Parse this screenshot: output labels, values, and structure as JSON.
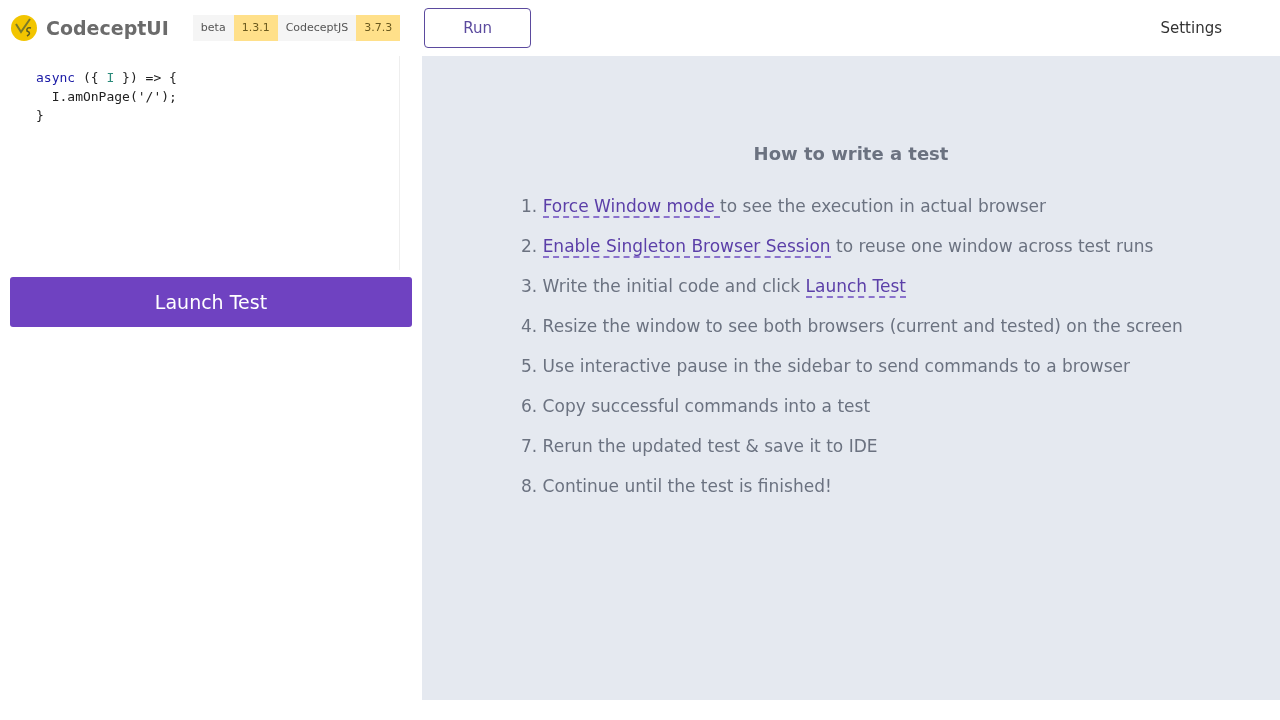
{
  "header": {
    "brand": "CodeceptUI",
    "badges": [
      {
        "label": "beta",
        "kind": "plain"
      },
      {
        "label": "1.3.1",
        "kind": "version"
      },
      {
        "label": "CodeceptJS",
        "kind": "plain"
      },
      {
        "label": "3.7.3",
        "kind": "version"
      }
    ],
    "run_button": "Run",
    "settings": "Settings"
  },
  "editor": {
    "lines": [
      [
        {
          "kind": "keyword",
          "text": "async"
        },
        {
          "kind": "plain",
          "text": " ({ "
        },
        {
          "kind": "identifier",
          "text": "I"
        },
        {
          "kind": "plain",
          "text": " }) => {"
        }
      ],
      [
        {
          "kind": "plain",
          "text": "  I.amOnPage('/');"
        }
      ],
      [
        {
          "kind": "plain",
          "text": "}"
        }
      ]
    ]
  },
  "launch_button": "Launch Test",
  "guide": {
    "title": "How to write a test",
    "steps": [
      [
        {
          "kind": "text",
          "text": "1. "
        },
        {
          "kind": "link",
          "text": "Force Window mode "
        },
        {
          "kind": "text",
          "text": "to see the execution in actual browser"
        }
      ],
      [
        {
          "kind": "text",
          "text": "2. "
        },
        {
          "kind": "link",
          "text": "Enable Singleton Browser Session"
        },
        {
          "kind": "text",
          "text": " to reuse one window across test runs"
        }
      ],
      [
        {
          "kind": "text",
          "text": "3. Write the initial code and click "
        },
        {
          "kind": "link",
          "text": "Launch Test"
        }
      ],
      [
        {
          "kind": "text",
          "text": "4. Resize the window to see both browsers (current and tested) on the screen"
        }
      ],
      [
        {
          "kind": "text",
          "text": "5. Use interactive pause in the sidebar to send commands to a browser"
        }
      ],
      [
        {
          "kind": "text",
          "text": "6. Copy successful commands into a test"
        }
      ],
      [
        {
          "kind": "text",
          "text": "7. Rerun the updated test & save it to IDE"
        }
      ],
      [
        {
          "kind": "text",
          "text": "8. Continue until the test is finished!"
        }
      ]
    ]
  }
}
